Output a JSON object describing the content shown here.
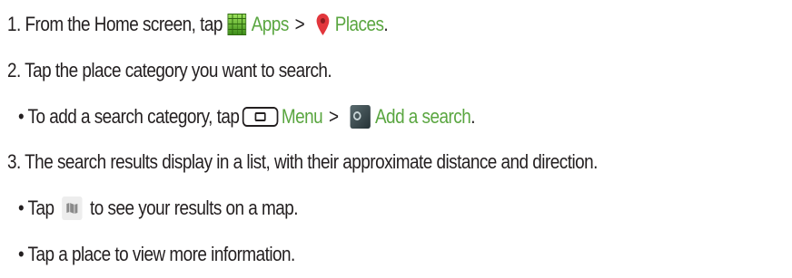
{
  "steps": [
    {
      "prefix": "1. From the Home screen, tap",
      "apps_label": "Apps",
      "separator": ">",
      "places_label": "Places",
      "suffix": "."
    },
    {
      "text": "2. Tap the place category you want to search."
    },
    {
      "prefix": "• To add a search category, tap",
      "menu_label": "Menu",
      "separator": ">",
      "add_search_label": "Add a search",
      "suffix": "."
    },
    {
      "text": "3. The search results display in a list, with their approximate distance and direction."
    },
    {
      "prefix": "• Tap",
      "suffix": "to see your results on a map."
    },
    {
      "text": "• Tap a place to view more information."
    }
  ],
  "colors": {
    "text": "#231f20",
    "link": "#5aa640"
  },
  "icons": {
    "apps": "apps-grid-icon",
    "places": "map-pin-icon",
    "menu": "menu-key-icon",
    "add_search": "add-search-icon",
    "map": "map-view-icon"
  }
}
